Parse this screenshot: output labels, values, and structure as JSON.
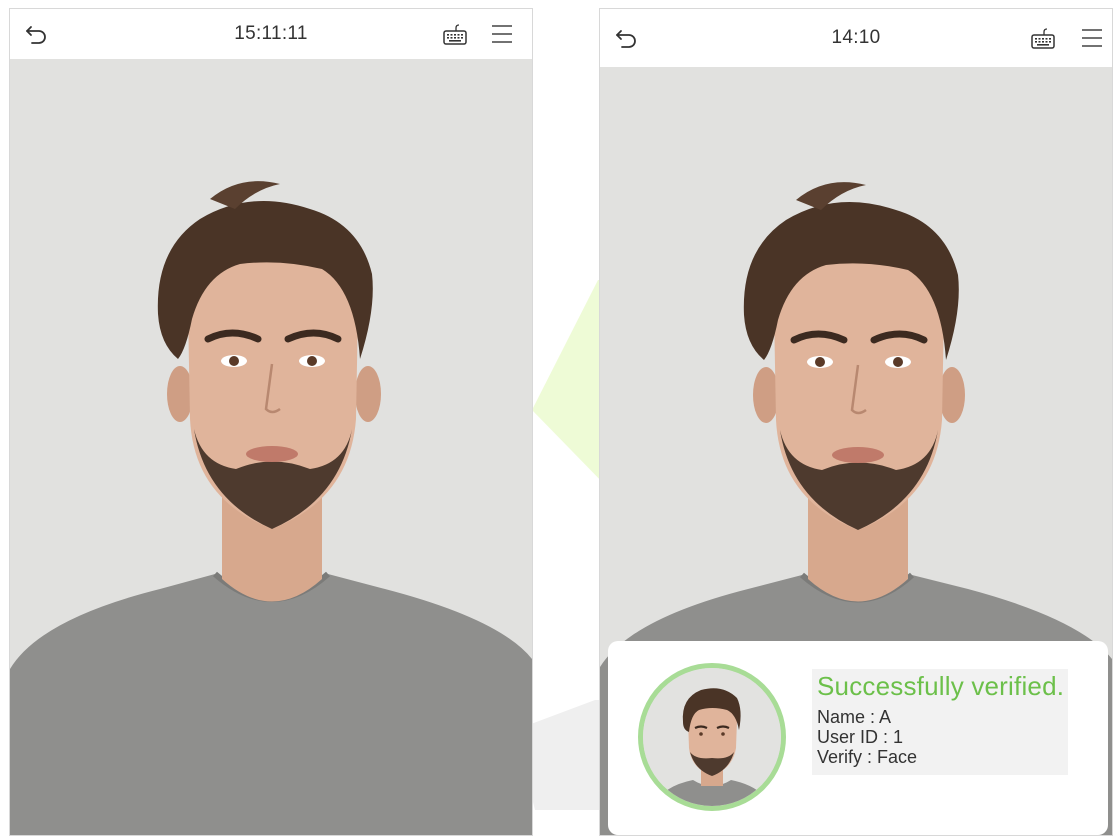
{
  "left_screen": {
    "time": "15:11:11",
    "icons": {
      "back": "back-arrow-icon",
      "keyboard": "keyboard-icon",
      "menu": "menu-icon"
    }
  },
  "right_screen": {
    "time": "14:10",
    "icons": {
      "back": "back-arrow-icon",
      "keyboard": "keyboard-icon",
      "menu": "menu-icon"
    },
    "verification": {
      "status": "Successfully verified.",
      "name_line": "Name : A",
      "user_id_line": "User ID : 1",
      "verify_line": "Verify : Face"
    }
  },
  "colors": {
    "success_text": "#6cc04a",
    "avatar_ring": "#a8dc96",
    "watermark_green": "#eefbd6",
    "watermark_gray": "#ececec"
  }
}
